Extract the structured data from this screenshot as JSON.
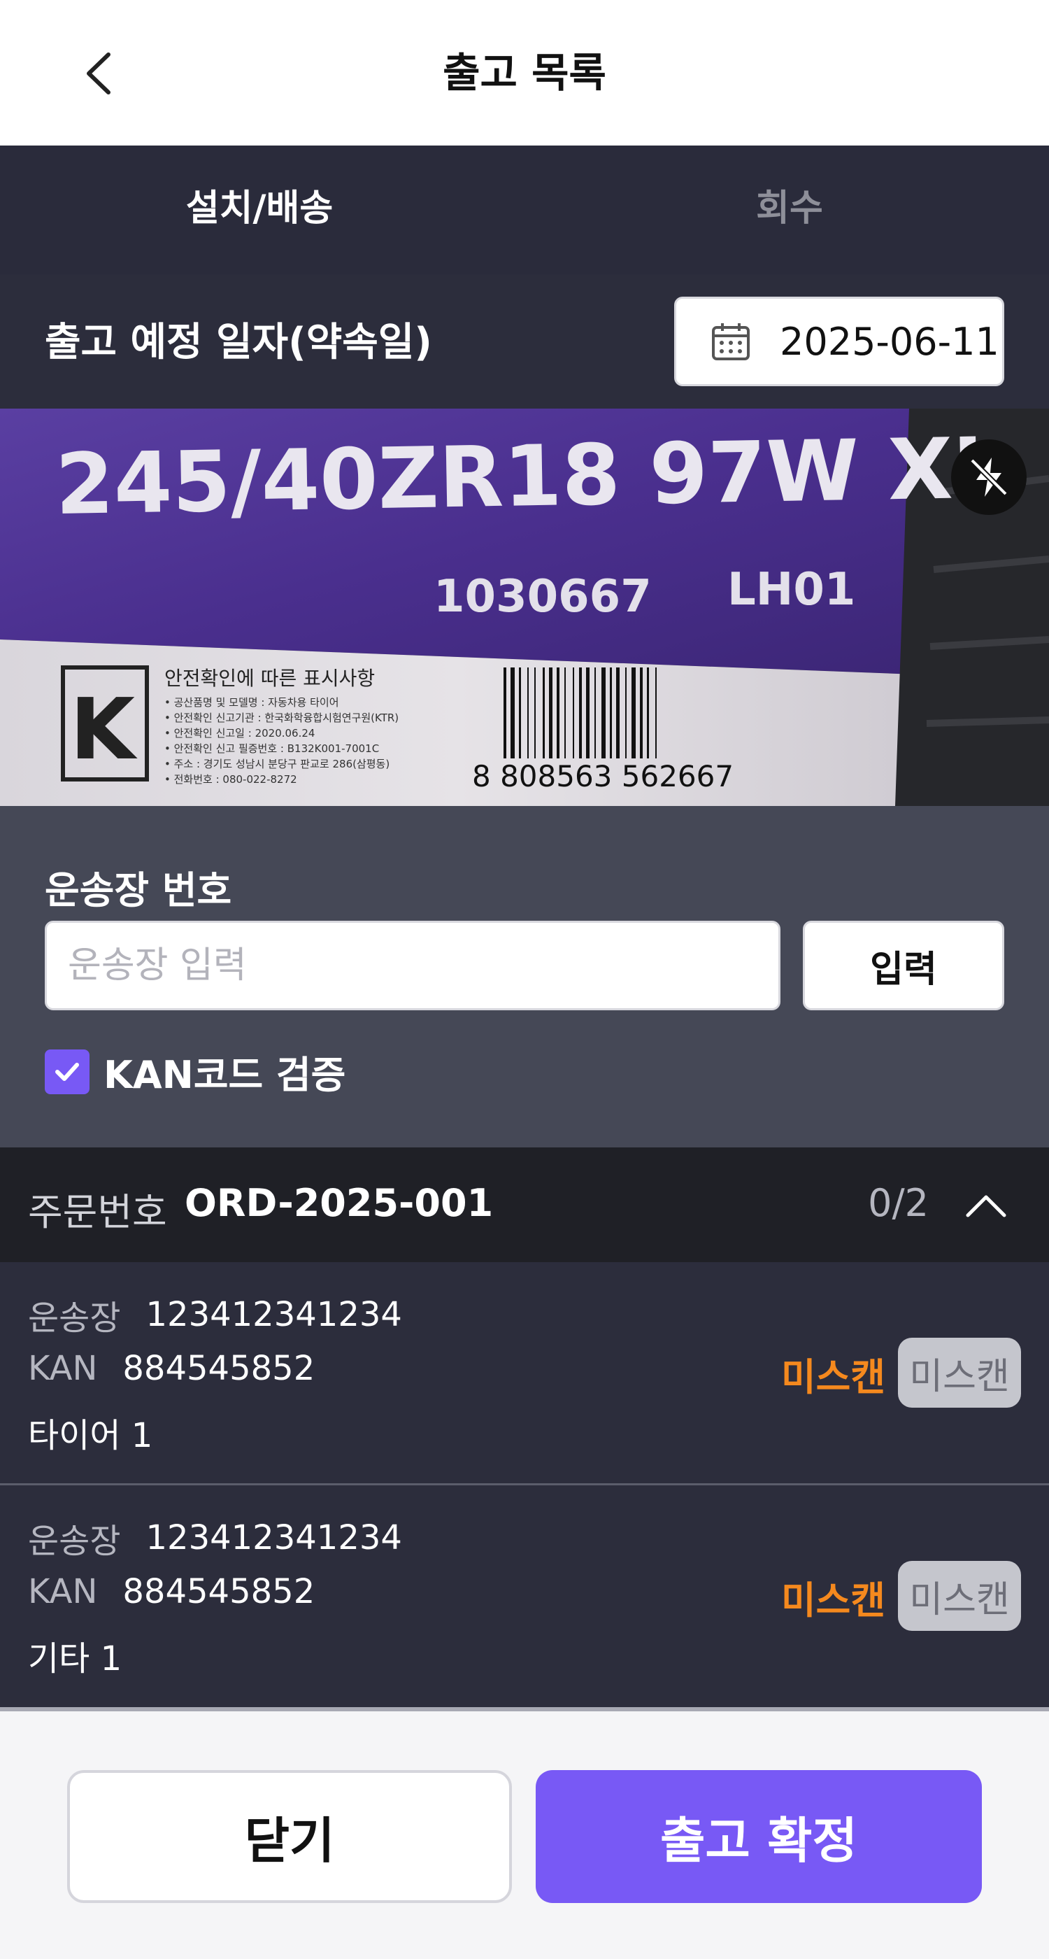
{
  "header": {
    "title": "출고 목록"
  },
  "tabs": [
    {
      "label": "설치/배송",
      "active": true
    },
    {
      "label": "회수",
      "active": false
    }
  ],
  "schedule": {
    "label": "출고 예정 일자(약속일)",
    "date": "2025-06-11"
  },
  "camera": {
    "size_text": "245/40ZR18 97W XL",
    "code_text": "1030667",
    "code2_text": "LH01",
    "notice_title": "안전확인에 따른 표시사항",
    "notice_lines": [
      "• 공산품명 및 모델명 : 자동차용 타이어",
      "• 안전확인 신고기관 : 한국화학융합시험연구원(KTR)",
      "• 안전확인 신고일 : 2020.06.24",
      "• 안전확인 신고 필증번호 : B132K001-7001C",
      "• 주소 : 경기도 성남시 분당구 판교로 286(삼평동)",
      "• 전화번호 : 080-022-8272"
    ],
    "barcode_text": "8 808563 562667"
  },
  "waybill": {
    "label": "운송장 번호",
    "placeholder": "운송장 입력",
    "value": "",
    "button": "입력",
    "kan_check_label": "KAN코드 검증",
    "kan_checked": true
  },
  "order": {
    "label": "주문번호",
    "number": "ORD-2025-001",
    "count": "0/2"
  },
  "items": [
    {
      "waybill_key": "운송장",
      "waybill": "123412341234",
      "kan_key": "KAN",
      "kan": "884545852",
      "product": "타이어 1",
      "status_text": "미스캔",
      "status_chip": "미스캔"
    },
    {
      "waybill_key": "운송장",
      "waybill": "123412341234",
      "kan_key": "KAN",
      "kan": "884545852",
      "product": "기타 1",
      "status_text": "미스캔",
      "status_chip": "미스캔"
    }
  ],
  "footer": {
    "close": "닫기",
    "confirm": "출고 확정"
  },
  "colors": {
    "accent": "#7859f5",
    "warning": "#f5891e",
    "dark_bg": "#2c2d3c",
    "section_bg": "#454856"
  }
}
